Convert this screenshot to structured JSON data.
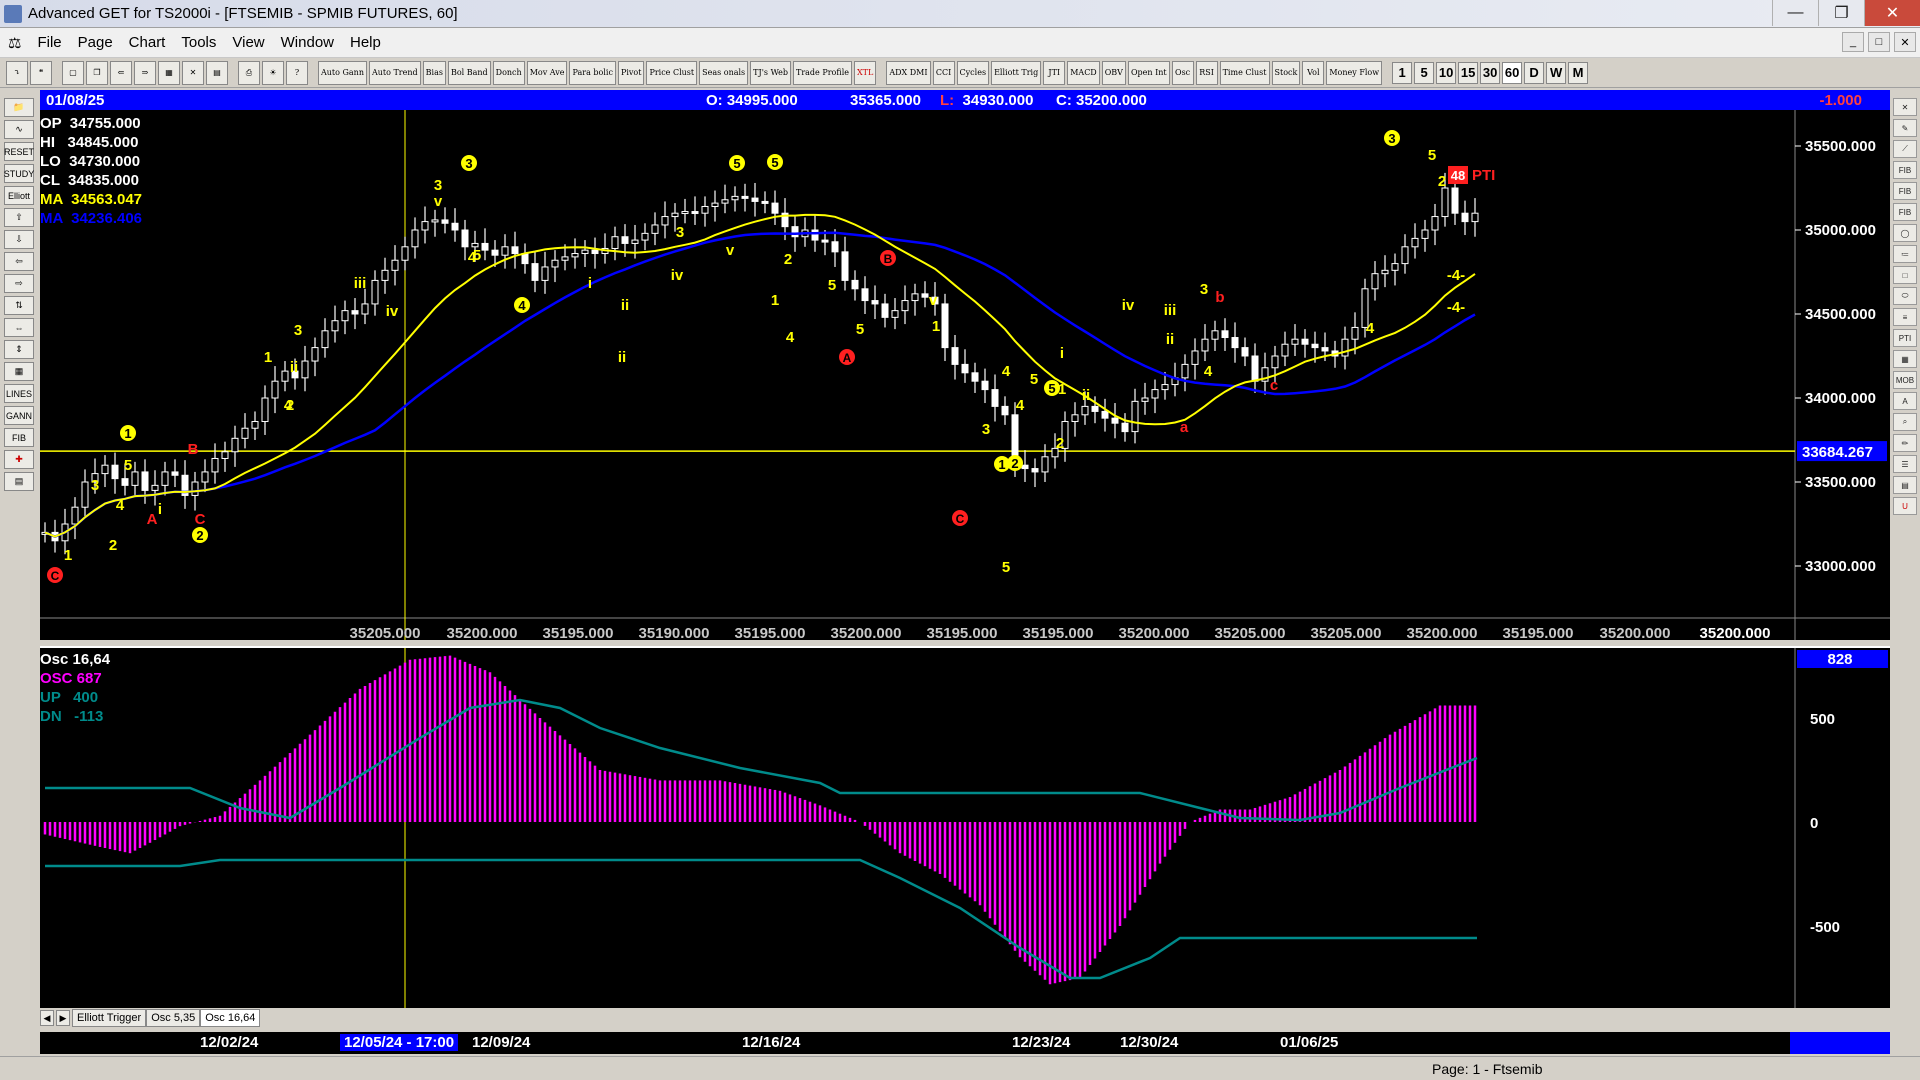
{
  "window": {
    "title": "Advanced GET for TS2000i - [FTSEMIB - SPMIB FUTURES, 60]"
  },
  "menu": [
    "File",
    "Page",
    "Chart",
    "Tools",
    "View",
    "Window",
    "Help"
  ],
  "toolbar": {
    "studies": [
      "Auto Gann",
      "Auto Trend",
      "Bias",
      "Bol Band",
      "Donch",
      "Mov Ave",
      "Para bolic",
      "Pivot",
      "Price Clust",
      "Seas onals",
      "TJ's Web",
      "Trade Profile",
      "XTL",
      "ADX DMI",
      "CCI",
      "Cycles",
      "Elliott Trig",
      "JTI",
      "MACD",
      "OBV",
      "Open Int",
      "Osc",
      "RSI",
      "Time Clust",
      "Stock",
      "Vol",
      "Money Flow"
    ],
    "periods": [
      "1",
      "5",
      "10",
      "15",
      "30",
      "60",
      "D",
      "W",
      "M"
    ],
    "active_period": "60"
  },
  "header": {
    "date": "01/08/25",
    "open": "O:  34995.000",
    "high": "35365.000",
    "low_label": "L:",
    "low": "34930.000",
    "close": "C:  35200.000",
    "change": "-1.000"
  },
  "legend": {
    "op": "OP  34755.000",
    "hi": "HI   34845.000",
    "lo": "LO  34730.000",
    "cl": "CL  34835.000",
    "ma1": "MA  34563.047",
    "ma2": "MA  34236.406"
  },
  "price_axis": {
    "ticks": [
      "35500.000",
      "35000.000",
      "34500.000",
      "34000.000",
      "33500.000",
      "33000.000"
    ],
    "current": "33684.267"
  },
  "bottom_values": [
    "35205.000",
    "35200.000",
    "35195.000",
    "35190.000",
    "35195.000",
    "35200.000",
    "35195.000",
    "35195.000",
    "35200.000",
    "35205.000",
    "35205.000",
    "35200.000",
    "35195.000",
    "35200.000",
    "35200.000"
  ],
  "pti": {
    "value": "48",
    "label": "PTI"
  },
  "osc_legend": {
    "title": "Osc 16,64",
    "osc": "OSC 687",
    "up": "UP   400",
    "dn": "DN   -113"
  },
  "osc_axis": {
    "current": "828",
    "ticks": [
      "500",
      "0",
      "-500"
    ]
  },
  "tabs": [
    "Elliott Trigger",
    "Osc 5,35",
    "Osc 16,64"
  ],
  "active_tab": "Osc 16,64",
  "dates": [
    "12/02/24",
    "12/05/24 - 17:00",
    "12/09/24",
    "12/16/24",
    "12/23/24",
    "12/30/24",
    "01/06/25"
  ],
  "status": {
    "page": "Page: 1 - Ftsemib"
  },
  "wave_labels": {
    "yellow": [
      "1",
      "2",
      "3",
      "4",
      "5",
      "3",
      "v",
      "5",
      "4",
      "iii",
      "iv",
      "i",
      "ii",
      "1",
      "2",
      "3",
      "4",
      "5",
      "v",
      "iv",
      "ii",
      "2",
      "1",
      "4",
      "5",
      "3",
      "1",
      "2",
      "3",
      "4",
      "5",
      "1",
      "2",
      "i",
      "ii",
      "iii",
      "iv",
      "v",
      "3",
      "4",
      "5",
      "3",
      "1",
      "-4-",
      "-4-"
    ],
    "circled_yellow": [
      "1",
      "2",
      "3",
      "4",
      "5",
      "3",
      "5",
      "1",
      "2",
      "3"
    ],
    "red": [
      "A",
      "B",
      "C",
      "a",
      "b",
      "c",
      "A",
      "B",
      "C"
    ]
  },
  "colors": {
    "ma_fast": "#ffff00",
    "ma_slow": "#0000ff",
    "osc": "#ff00ff",
    "band": "#008b8b",
    "header": "#0000ff"
  }
}
